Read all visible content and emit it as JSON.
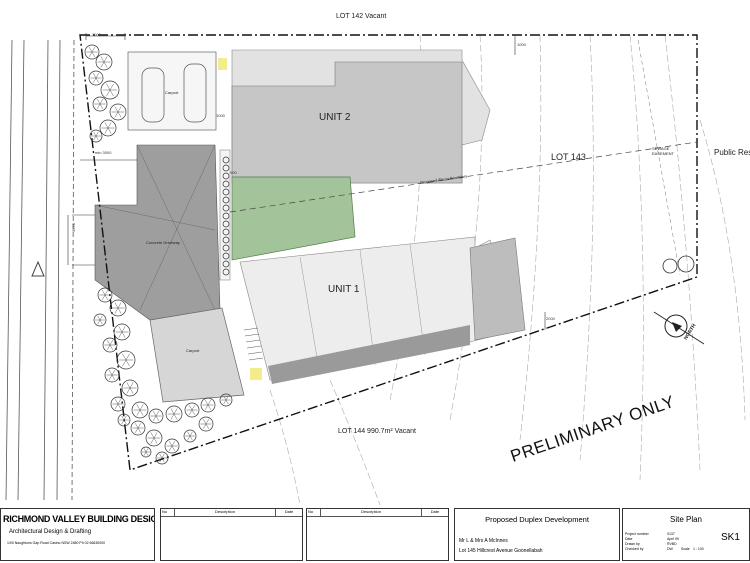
{
  "site": {
    "lot_142": "LOT 142  Vacant",
    "lot_143": "LOT 143",
    "lot_144": "LOT 144  990.7m²  Vacant",
    "public_reserve": "Public Rese",
    "unit_1": "UNIT 1",
    "unit_2": "UNIT 2",
    "carport": "Carport",
    "concrete_driveway": "Concrete Driveway",
    "boundary": "Proposed Strata Boundary",
    "easement": "SEWAGE EASEMENT",
    "preliminary": "PRELIMINARY ONLY",
    "north": "NORTH",
    "dims": {
      "min3000": "min 3000",
      "d1000": "1000",
      "d900": "900",
      "d3578": "3578",
      "d2000": "2000"
    }
  },
  "title_block": {
    "company": "RICHMOND VALLEY BUILDING DESIGN",
    "tagline": "Architectural Design & Drafting",
    "address": "1/00 Naughtons Gap Road Casino  NSW 2480  Ph 02 66630000",
    "rev_headers": [
      "No",
      "Description",
      "Date"
    ],
    "project": "Proposed Duplex Development",
    "client": "Mr L & Mrs A McInnes",
    "location": "Lot 145 Hillcrest Avenue Goonellabah",
    "sheet_title": "Site Plan",
    "sheet_no": "SK1",
    "meta_labels": [
      "Project number",
      "Date",
      "Drawn by",
      "Checked by"
    ],
    "meta_values": [
      "0137",
      "April 09",
      "RVBD",
      "DW"
    ],
    "scale_label": "Scale",
    "scale_value": "1 : 100"
  }
}
